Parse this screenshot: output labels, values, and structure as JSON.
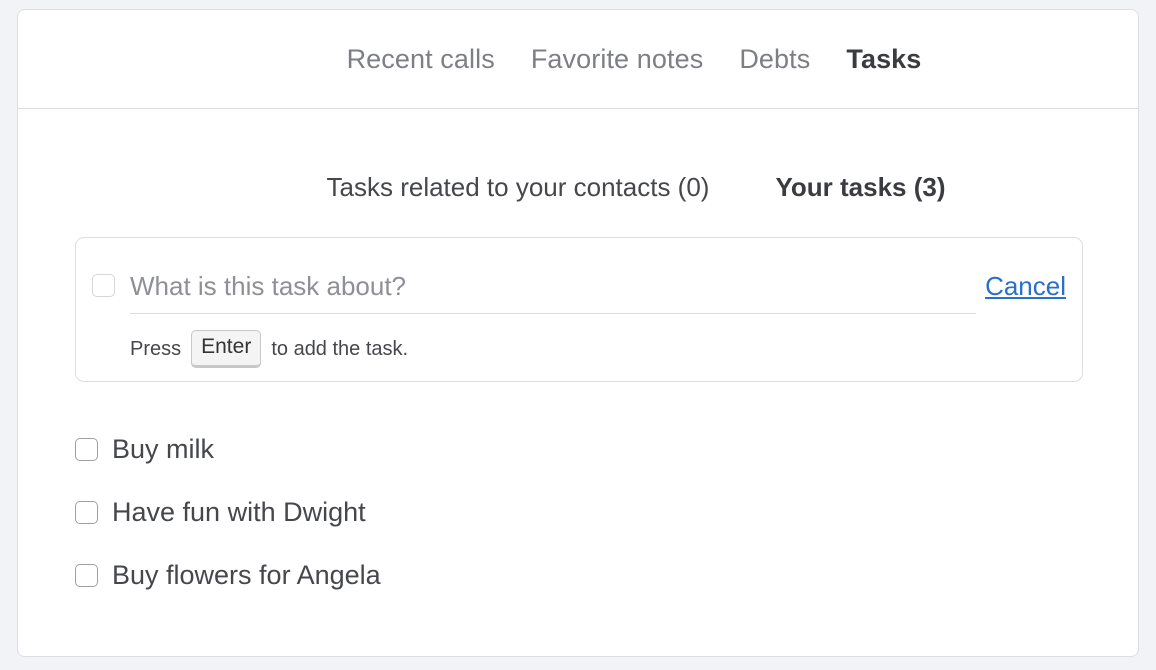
{
  "main_tabs": [
    {
      "label": "Recent calls",
      "active": false
    },
    {
      "label": "Favorite notes",
      "active": false
    },
    {
      "label": "Debts",
      "active": false
    },
    {
      "label": "Tasks",
      "active": true
    }
  ],
  "sub_tabs": [
    {
      "label": "Tasks related to your contacts (0)",
      "active": false
    },
    {
      "label": "Your tasks (3)",
      "active": true
    }
  ],
  "new_task": {
    "placeholder": "What is this task about?",
    "value": "",
    "cancel_label": "Cancel",
    "hint_before": "Press",
    "hint_key": "Enter",
    "hint_after": "to add the task."
  },
  "tasks": [
    {
      "label": "Buy milk",
      "done": false
    },
    {
      "label": "Have fun with Dwight",
      "done": false
    },
    {
      "label": "Buy flowers for Angela",
      "done": false
    }
  ],
  "colors": {
    "background": "#f2f3f7",
    "card": "#ffffff",
    "border": "#dcdee4",
    "link": "#2a6fc9"
  }
}
